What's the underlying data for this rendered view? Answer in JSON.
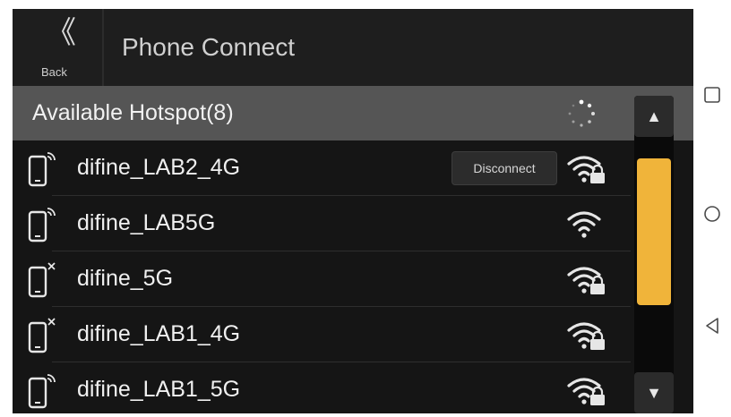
{
  "header": {
    "back_label": "Back",
    "title": "Phone Connect"
  },
  "section": {
    "title": "Available Hotspot(8)"
  },
  "hotspots": [
    {
      "name": "difine_LAB2_4G",
      "phone_icon": "phone-signal-icon",
      "wifi_icon": "wifi-locked-icon",
      "action": "Disconnect"
    },
    {
      "name": "difine_LAB5G",
      "phone_icon": "phone-signal-icon",
      "wifi_icon": "wifi-open-icon"
    },
    {
      "name": "difine_5G",
      "phone_icon": "phone-unavailable-icon",
      "wifi_icon": "wifi-locked-icon"
    },
    {
      "name": "difine_LAB1_4G",
      "phone_icon": "phone-unavailable-icon",
      "wifi_icon": "wifi-locked-icon"
    },
    {
      "name": "difine_LAB1_5G",
      "phone_icon": "phone-signal-icon",
      "wifi_icon": "wifi-locked-icon"
    }
  ],
  "scrollbar": {
    "up_icon": "triangle-up-icon",
    "down_icon": "triangle-down-icon",
    "accent": "#f0b43a"
  },
  "system_nav": [
    "square-recents-icon",
    "circle-home-icon",
    "triangle-back-icon"
  ]
}
